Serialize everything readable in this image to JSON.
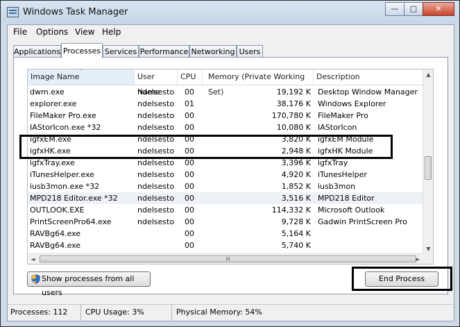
{
  "window": {
    "title": "Windows Task Manager"
  },
  "menu": [
    "File",
    "Options",
    "View",
    "Help"
  ],
  "tabs": [
    "Applications",
    "Processes",
    "Services",
    "Performance",
    "Networking",
    "Users"
  ],
  "columns": [
    "Image Name",
    "User Name",
    "CPU",
    "Memory (Private Working Set)",
    "Description"
  ],
  "rows": [
    {
      "image": "dwm.exe",
      "user": "ndelsesto",
      "cpu": "00",
      "mem": "19,192 K",
      "desc": "Desktop Window Manager"
    },
    {
      "image": "explorer.exe",
      "user": "ndelsesto",
      "cpu": "01",
      "mem": "38,176 K",
      "desc": "Windows Explorer"
    },
    {
      "image": "FileMaker Pro.exe",
      "user": "ndelsesto",
      "cpu": "00",
      "mem": "170,780 K",
      "desc": "FileMaker Pro"
    },
    {
      "image": "IAStorIcon.exe *32",
      "user": "ndelsesto",
      "cpu": "00",
      "mem": "10,080 K",
      "desc": "IAStorIcon"
    },
    {
      "image": "igfxEM.exe",
      "user": "ndelsesto",
      "cpu": "00",
      "mem": "3,820 K",
      "desc": "igfxEM Module"
    },
    {
      "image": "igfxHK.exe",
      "user": "ndelsesto",
      "cpu": "00",
      "mem": "2,948 K",
      "desc": "igfxHK Module"
    },
    {
      "image": "igfxTray.exe",
      "user": "ndelsesto",
      "cpu": "00",
      "mem": "3,396 K",
      "desc": "igfxTray"
    },
    {
      "image": "iTunesHelper.exe",
      "user": "ndelsesto",
      "cpu": "00",
      "mem": "4,920 K",
      "desc": "iTunesHelper"
    },
    {
      "image": "iusb3mon.exe *32",
      "user": "ndelsesto",
      "cpu": "00",
      "mem": "1,852 K",
      "desc": "iusb3mon"
    },
    {
      "image": "MPD218 Editor.exe *32",
      "user": "ndelsesto",
      "cpu": "00",
      "mem": "3,516 K",
      "desc": "MPD218 Editor"
    },
    {
      "image": "OUTLOOK.EXE",
      "user": "ndelsesto",
      "cpu": "00",
      "mem": "114,332 K",
      "desc": "Microsoft Outlook"
    },
    {
      "image": "PrintScreenPro64.exe",
      "user": "ndelsesto",
      "cpu": "00",
      "mem": "9,728 K",
      "desc": "Gadwin PrintScreen Pro"
    },
    {
      "image": "RAVBg64.exe",
      "user": "",
      "cpu": "00",
      "mem": "5,164 K",
      "desc": ""
    },
    {
      "image": "RAVBg64.exe",
      "user": "",
      "cpu": "00",
      "mem": "5,740 K",
      "desc": ""
    }
  ],
  "buttons": {
    "show_all": "Show processes from all users",
    "end_process": "End Process"
  },
  "status": {
    "processes": "Processes: 112",
    "cpu": "CPU Usage: 3%",
    "memory": "Physical Memory: 54%"
  },
  "controls": {
    "minimize": "—",
    "maximize": "□",
    "close": "✕"
  },
  "scroll": {
    "up": "▲",
    "down": "▼",
    "left": "◄",
    "right": "►",
    "grip": "III"
  },
  "sort_indicator": "⌃"
}
